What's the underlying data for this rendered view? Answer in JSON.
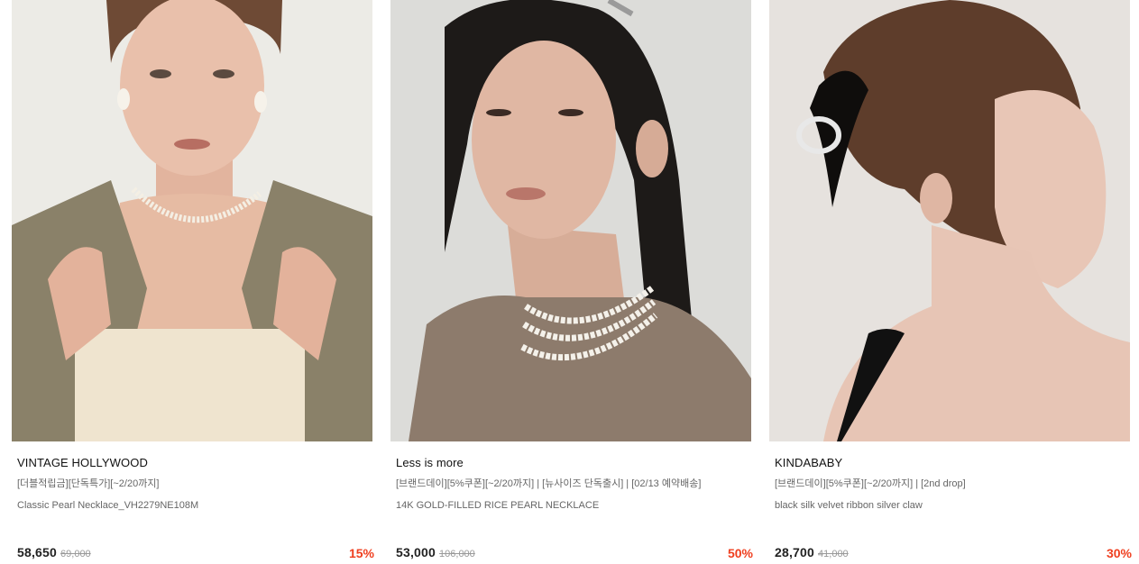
{
  "products": [
    {
      "brand": "VINTAGE HOLLYWOOD",
      "tags": "[더블적립금][단독특가][~2/20까지]",
      "name": "Classic Pearl Necklace_VH2279NE108M",
      "price": "58,650",
      "original_price": "69,000",
      "discount": "15%",
      "image_label": "model wearing pearl choker and blazer"
    },
    {
      "brand": "Less is more",
      "tags": "[브랜드데이][5%쿠폰][~2/20까지] | [뉴사이즈 단독출시] | [02/13 예약배송]",
      "name": "14K GOLD-FILLED RICE PEARL NECKLACE",
      "price": "53,000",
      "original_price": "106,000",
      "discount": "50%",
      "image_label": "model wearing layered rice pearl necklace"
    },
    {
      "brand": "KINDABABY",
      "tags": "[브랜드데이][5%쿠폰][~2/20까지] | [2nd drop]",
      "name": "black silk velvet ribbon silver claw",
      "price": "28,700",
      "original_price": "41,000",
      "discount": "30%",
      "image_label": "model profile with velvet ribbon hair claw"
    }
  ],
  "colors": {
    "discount": "#ef3f1f",
    "text_primary": "#111111",
    "text_secondary": "#666666",
    "strike": "#999999"
  }
}
